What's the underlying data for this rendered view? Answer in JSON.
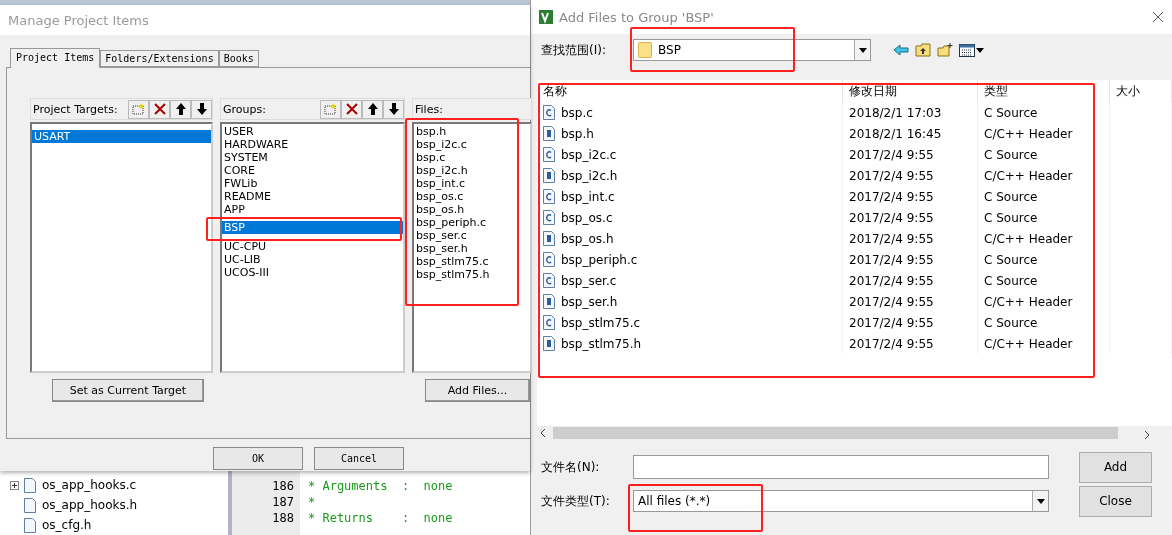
{
  "manage_dialog": {
    "title": "Manage Project Items",
    "tabs": [
      {
        "label": "Project Items",
        "selected": true
      },
      {
        "label": "Folders/Extensions",
        "selected": false
      },
      {
        "label": "Books",
        "selected": false
      }
    ],
    "targets": {
      "label": "Project Targets:",
      "items": [
        {
          "label": "USART",
          "selected": true
        }
      ]
    },
    "groups": {
      "label": "Groups:",
      "items": [
        {
          "label": "USER",
          "selected": false
        },
        {
          "label": "HARDWARE",
          "selected": false
        },
        {
          "label": "SYSTEM",
          "selected": false
        },
        {
          "label": "CORE",
          "selected": false
        },
        {
          "label": "FWLib",
          "selected": false
        },
        {
          "label": "README",
          "selected": false
        },
        {
          "label": "APP",
          "selected": false
        },
        {
          "label": "BSP",
          "selected": true
        },
        {
          "label": "UC-CPU",
          "selected": false
        },
        {
          "label": "UC-LIB",
          "selected": false
        },
        {
          "label": "UCOS-III",
          "selected": false
        }
      ]
    },
    "files": {
      "label": "Files:",
      "items": [
        "bsp.h",
        "bsp_i2c.c",
        "bsp.c",
        "bsp_i2c.h",
        "bsp_int.c",
        "bsp_os.c",
        "bsp_os.h",
        "bsp_periph.c",
        "bsp_ser.c",
        "bsp_ser.h",
        "bsp_stlm75.c",
        "bsp_stlm75.h"
      ]
    },
    "set_target_button": "Set as Current Target",
    "add_files_button": "Add Files...",
    "footer_buttons": [
      "OK",
      "Cancel"
    ]
  },
  "ide": {
    "tree": [
      {
        "label": "os_app_hooks.c",
        "expandable": true
      },
      {
        "label": "os_app_hooks.h",
        "expandable": false
      },
      {
        "label": "os_cfg.h",
        "expandable": false
      }
    ],
    "code": [
      {
        "line": "186",
        "text": "* Arguments  :  none"
      },
      {
        "line": "187",
        "text": "*"
      },
      {
        "line": "188",
        "text": "* Returns    :  none"
      }
    ]
  },
  "add_dialog": {
    "title": "Add Files to Group 'BSP'",
    "look_in": {
      "label": "查找范围(I):",
      "value": "BSP"
    },
    "columns": [
      "名称",
      "修改日期",
      "类型",
      "大小"
    ],
    "rows": [
      {
        "name": "bsp.c",
        "date": "2018/2/1 17:03",
        "type": "C Source",
        "kind": "c"
      },
      {
        "name": "bsp.h",
        "date": "2018/2/1 16:45",
        "type": "C/C++ Header",
        "kind": "h"
      },
      {
        "name": "bsp_i2c.c",
        "date": "2017/2/4 9:55",
        "type": "C Source",
        "kind": "c"
      },
      {
        "name": "bsp_i2c.h",
        "date": "2017/2/4 9:55",
        "type": "C/C++ Header",
        "kind": "h"
      },
      {
        "name": "bsp_int.c",
        "date": "2017/2/4 9:55",
        "type": "C Source",
        "kind": "c"
      },
      {
        "name": "bsp_os.c",
        "date": "2017/2/4 9:55",
        "type": "C Source",
        "kind": "c"
      },
      {
        "name": "bsp_os.h",
        "date": "2017/2/4 9:55",
        "type": "C/C++ Header",
        "kind": "h"
      },
      {
        "name": "bsp_periph.c",
        "date": "2017/2/4 9:55",
        "type": "C Source",
        "kind": "c"
      },
      {
        "name": "bsp_ser.c",
        "date": "2017/2/4 9:55",
        "type": "C Source",
        "kind": "c"
      },
      {
        "name": "bsp_ser.h",
        "date": "2017/2/4 9:55",
        "type": "C/C++ Header",
        "kind": "h"
      },
      {
        "name": "bsp_stlm75.c",
        "date": "2017/2/4 9:55",
        "type": "C Source",
        "kind": "c"
      },
      {
        "name": "bsp_stlm75.h",
        "date": "2017/2/4 9:55",
        "type": "C/C++ Header",
        "kind": "h"
      }
    ],
    "file_name": {
      "label": "文件名(N):"
    },
    "file_type": {
      "label": "文件类型(T):",
      "value": "All files (*.*)"
    },
    "buttons": [
      "Add",
      "Close"
    ]
  }
}
